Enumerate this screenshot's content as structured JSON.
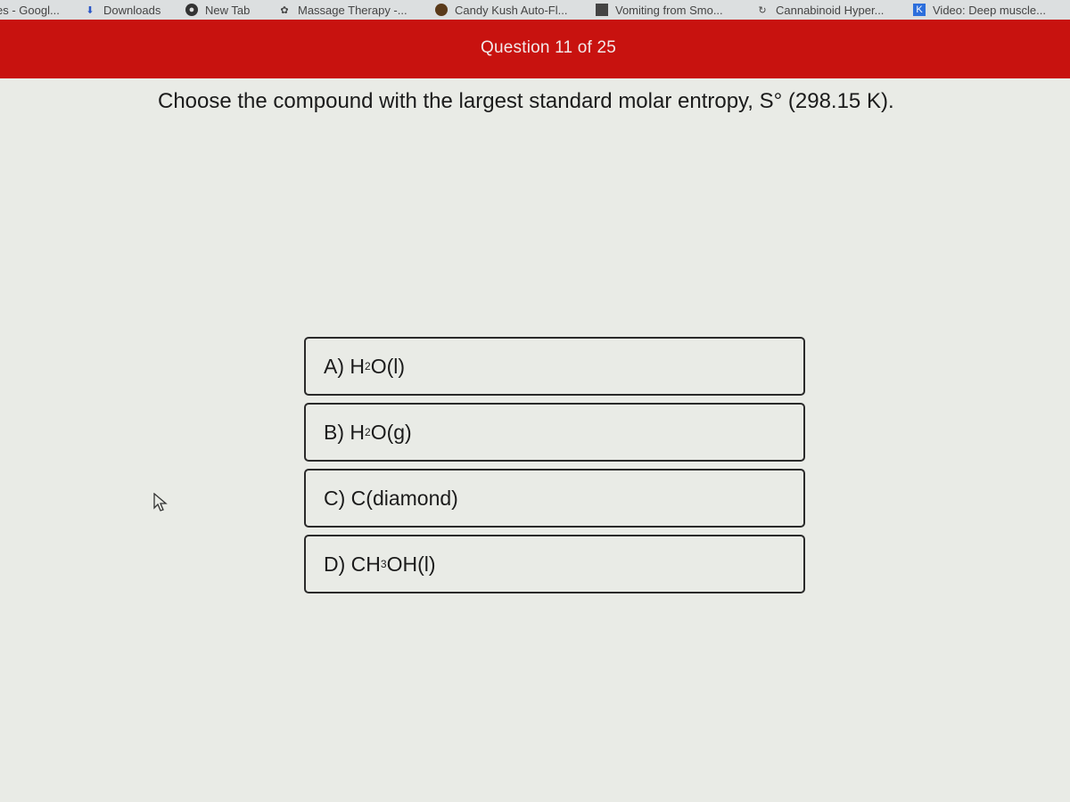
{
  "bookmarks": [
    {
      "label": "es - Googl...",
      "icon": "google-icon"
    },
    {
      "label": "Downloads",
      "icon": "download-icon"
    },
    {
      "label": "New Tab",
      "icon": "globe-icon"
    },
    {
      "label": "Massage Therapy -...",
      "icon": "site-icon"
    },
    {
      "label": "Candy Kush Auto-Fl...",
      "icon": "site-icon"
    },
    {
      "label": "Vomiting from Smo...",
      "icon": "site-icon"
    },
    {
      "label": "Cannabinoid Hyper...",
      "icon": "site-icon"
    },
    {
      "label": "Video: Deep muscle...",
      "icon": "k-icon"
    }
  ],
  "header": {
    "title": "Question 11 of 25",
    "color": "#c8120f"
  },
  "question": {
    "text": "Choose the compound with the largest standard molar entropy, S° (298.15 K)."
  },
  "options": [
    {
      "letter": "A)",
      "pre": "H",
      "sub": "2",
      "post": "O(l)"
    },
    {
      "letter": "B)",
      "pre": "H",
      "sub": "2",
      "post": "O(g)"
    },
    {
      "letter": "C)",
      "pre": "C(diamond)",
      "sub": "",
      "post": ""
    },
    {
      "letter": "D)",
      "pre": "CH",
      "sub": "3",
      "post": "OH(l)"
    }
  ]
}
